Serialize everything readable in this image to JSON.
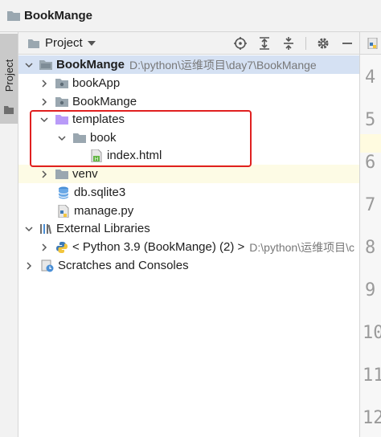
{
  "window": {
    "title": "BookMange"
  },
  "sidebar": {
    "tab_label": "Project"
  },
  "toolbar": {
    "view_label": "Project"
  },
  "tree": {
    "root": {
      "name": "BookMange",
      "path": "D:\\python\\运维项目\\day7\\BookMange"
    },
    "bookapp": "bookApp",
    "bookmange_dir": "BookMange",
    "templates": "templates",
    "book": "book",
    "index": "index.html",
    "venv": "venv",
    "db": "db.sqlite3",
    "manage": "manage.py",
    "external": "External Libraries",
    "python": {
      "name": "< Python 3.9 (BookMange) (2) >",
      "path": "D:\\python\\运维项目\\c"
    },
    "scratches": "Scratches and Consoles"
  },
  "editor": {
    "line_numbers": [
      "4",
      "5",
      "6",
      "7",
      "8",
      "9",
      "10",
      "11",
      "12"
    ]
  },
  "colors": {
    "selection": "#d5e1f3",
    "highlight": "#fdfbe5",
    "annotation": "#e02020",
    "folder": "#9aa7b0",
    "template_folder": "#b99bf8"
  }
}
